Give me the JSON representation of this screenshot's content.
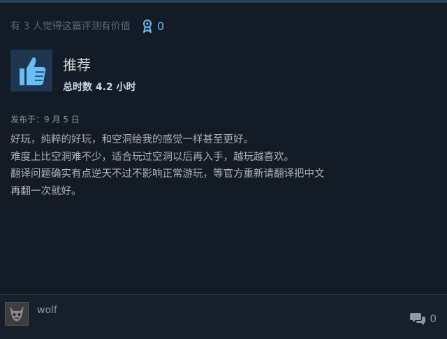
{
  "review": {
    "helpful_text": "有 3 人觉得这篇评测有价值",
    "award_count": "0",
    "verdict": "推荐",
    "hours": "总时数 4.2 小时",
    "posted": "发布于：9 月 5 日",
    "body_lines": [
      "好玩，纯粹的好玩，和空洞给我的感觉一样甚至更好。",
      "难度上比空洞难不少，适合玩过空洞以后再入手，越玩越喜欢。",
      "翻译问题确实有点逆天不过不影响正常游玩，等官方重新请翻译把中文",
      "再翻一次就好。"
    ]
  },
  "author": {
    "username": "wolf"
  },
  "comments": {
    "count": "0"
  },
  "icons": {
    "award": "award-ribbon-icon",
    "thumb": "thumbs-up-icon",
    "comment": "comment-bubbles-icon"
  },
  "colors": {
    "accent": "#66c0f4",
    "background": "#16202d",
    "card": "#121b26"
  }
}
